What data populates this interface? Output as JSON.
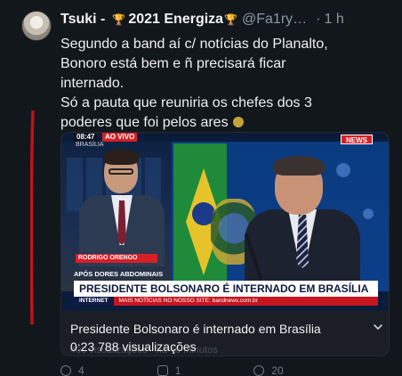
{
  "tweet": {
    "author_name": "Tsuki -",
    "author_badge": "2021 Energiza",
    "handle": "@Fa1ry…",
    "separator": "·",
    "time": "1 h",
    "text": "Segundo a band aí c/ notícias do Planalto,\nBonoro está bem e ñ precisará ficar\ninternado.\nSó a pauta que reuniria os chefes dos 3\npoderes que foi pelos ares"
  },
  "video": {
    "clock": "08:47",
    "live": "AO VIVO",
    "location": "BRASÍLIA",
    "logo": "NEWS",
    "name_tag": "RODRIGO ORENGO",
    "kicker": "APÓS DORES ABDOMINAIS",
    "headline": "PRESIDENTE BOLSONARO É INTERNADO EM BRASÍLIA",
    "ticker_label": "INTERNET",
    "ticker_text": "MAIS NOTÍCIAS NO NOSSO SITE: bandnews.com.br"
  },
  "media": {
    "title": "Presidente Bolsonaro é internado em Brasília",
    "stats": "0:23  788 visualizações",
    "ghost": "400 visualizações · há 40 minutos"
  },
  "actions": {
    "reply_count": "4",
    "retweet_count": "1",
    "like_count": "20"
  },
  "colors": {
    "background": "#12171c",
    "annotation": "#c0121a",
    "secondary_text": "#8b98a5"
  },
  "icons": {
    "badge": "trophy-icon",
    "expand": "chevron-down-icon"
  }
}
